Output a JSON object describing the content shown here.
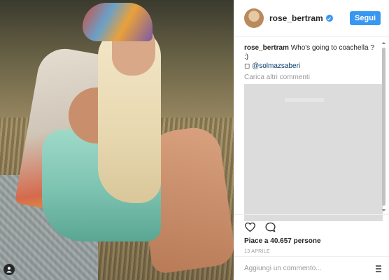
{
  "post": {
    "username": "rose_bertram",
    "follow_label": "Segui",
    "caption_user": "rose_bertram",
    "caption_text": " Who's going to coachella ? :)",
    "caption_symbol": "◻",
    "caption_mention": "@solmazsaberi",
    "load_more": "Carica altri commenti",
    "likes": "Piace a 40.657 persone",
    "date": "13 APRILE",
    "comment_placeholder": "Aggiungi un commento..."
  },
  "colors": {
    "accent": "#3897f0",
    "text": "#262626",
    "muted": "#999999"
  },
  "icons": {
    "like": "heart-icon",
    "comment": "comment-bubble-icon",
    "verified": "verified-badge-icon",
    "tag": "user-tag-icon",
    "more": "more-options-icon"
  }
}
